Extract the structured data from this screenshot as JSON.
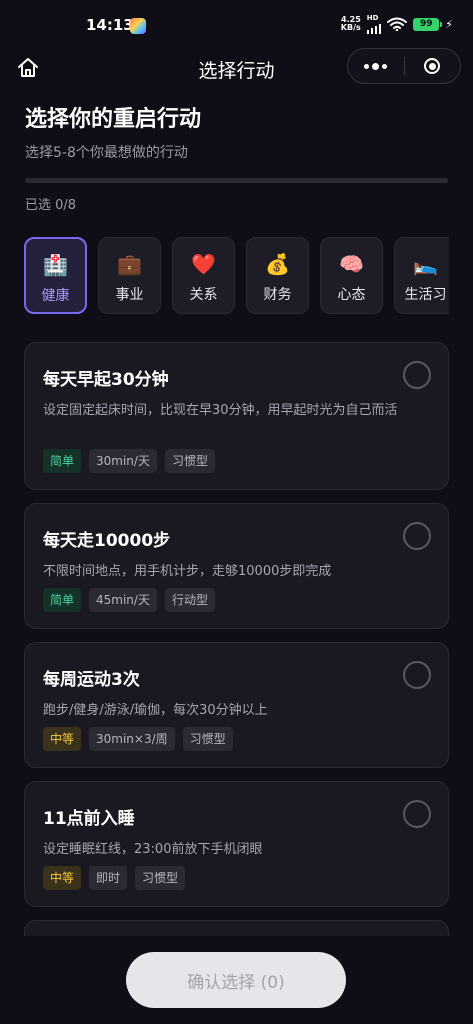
{
  "status_bar": {
    "time": "14:13",
    "net_speed_value": "4.25",
    "net_speed_unit": "KB/s",
    "network_type": "HD",
    "battery_level": "99",
    "icons": [
      "app-icon",
      "signal-icon",
      "wifi-icon",
      "battery-icon",
      "charging-bolt-icon"
    ]
  },
  "nav": {
    "title": "选择行动",
    "home_icon": "home-icon",
    "more_icon": "more-dots-icon",
    "close_icon": "target-circle-icon"
  },
  "header": {
    "title": "选择你的重启行动",
    "subtitle": "选择5-8个你最想做的行动",
    "progress": 0,
    "selected_count": "已选 0/8"
  },
  "categories": [
    {
      "emoji": "🏥",
      "label": "健康",
      "active": true
    },
    {
      "emoji": "💼",
      "label": "事业",
      "active": false
    },
    {
      "emoji": "❤️",
      "label": "关系",
      "active": false
    },
    {
      "emoji": "💰",
      "label": "财务",
      "active": false
    },
    {
      "emoji": "🧠",
      "label": "心态",
      "active": false
    },
    {
      "emoji": "🛌",
      "label": "生活习",
      "active": false
    }
  ],
  "actions": [
    {
      "title": "每天早起30分钟",
      "desc": "设定固定起床时间，比现在早30分钟，用早起时光为自己而活",
      "tags": [
        {
          "text": "简单",
          "kind": "easy"
        },
        {
          "text": "30min/天",
          "kind": "plain"
        },
        {
          "text": "习惯型",
          "kind": "plain"
        }
      ],
      "selected": false
    },
    {
      "title": "每天走10000步",
      "desc": "不限时间地点，用手机计步，走够10000步即完成",
      "tags": [
        {
          "text": "简单",
          "kind": "easy"
        },
        {
          "text": "45min/天",
          "kind": "plain"
        },
        {
          "text": "行动型",
          "kind": "plain"
        }
      ],
      "selected": false
    },
    {
      "title": "每周运动3次",
      "desc": "跑步/健身/游泳/瑜伽，每次30分钟以上",
      "tags": [
        {
          "text": "中等",
          "kind": "medium"
        },
        {
          "text": "30min×3/周",
          "kind": "plain"
        },
        {
          "text": "习惯型",
          "kind": "plain"
        }
      ],
      "selected": false
    },
    {
      "title": "11点前入睡",
      "desc": "设定睡眠红线，23:00前放下手机闭眼",
      "tags": [
        {
          "text": "中等",
          "kind": "medium"
        },
        {
          "text": "即时",
          "kind": "plain"
        },
        {
          "text": "习惯型",
          "kind": "plain"
        }
      ],
      "selected": false
    }
  ],
  "colors": {
    "accent": "#7a68f0",
    "easy": "#4cd39a",
    "medium": "#f3c84a",
    "background": "#0f0e16"
  },
  "bottom": {
    "confirm_label": "确认选择 (0)"
  }
}
